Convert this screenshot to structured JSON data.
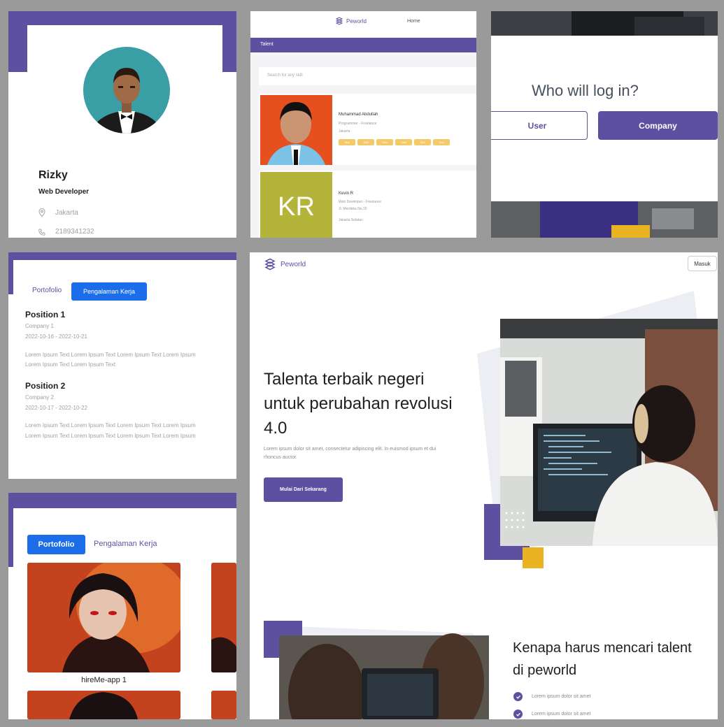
{
  "profile": {
    "name": "Rizky",
    "role": "Web Developer",
    "location": "Jakarta",
    "phone": "2189341232"
  },
  "talent_list": {
    "brand": "Peworld",
    "nav_link": "Home",
    "bar_title": "Talent",
    "search_placeholder": "Search for any skill",
    "items": [
      {
        "photo": "person-photo",
        "name": "Muhammad Abdullah",
        "role": "Programmer - Freelance",
        "location": "Jakarta",
        "skills": [
          "Skill",
          "Skill",
          "Skill",
          "Skill",
          "Skill",
          "Skill"
        ]
      },
      {
        "initials": "KR",
        "name": "Kevin R",
        "role": "Web Developer - Freelance",
        "location": "Jl. Merdeka No.15",
        "extra": "Jakarta Selatan"
      }
    ]
  },
  "login": {
    "question": "Who will log in?",
    "user_label": "User",
    "company_label": "Company"
  },
  "experience": {
    "tab_portfolio": "Portofolio",
    "tab_experience": "Pengalaman Kerja",
    "positions": [
      {
        "title": "Position 1",
        "company": "Company 1",
        "dates": "2022-10-16 - 2022-10-21",
        "desc1": "Lorem Ipsum Text Lorem Ipsum Text Lorem Ipsum Text Lorem Ipsum",
        "desc2": "Lorem Ipsum Text Lorem Ipsum Text"
      },
      {
        "title": "Position 2",
        "company": "Company 2",
        "dates": "2022-10-17 - 2022-10-22",
        "desc1": "Lorem Ipsum Text Lorem Ipsum Text Lorem Ipsum Text Lorem Ipsum",
        "desc2": "Lorem Ipsum Text Lorem Ipsum Text Lorem Ipsum Text Lorem Ipsum"
      }
    ]
  },
  "portfolio": {
    "tab_portfolio": "Portofolio",
    "tab_experience": "Pengalaman Kerja",
    "caption": "hireMe-app 1"
  },
  "landing": {
    "brand": "Peworld",
    "login_button": "Masuk",
    "headline": "Talenta terbaik negeri untuk perubahan revolusi 4.0",
    "lead": "Lorem ipsum dolor sit amet, consectetur adipiscing elit. In euismod ipsum et dui rhoncus auctor.",
    "cta": "Mulai Dari Sekarang",
    "section_title_1": "Kenapa harus mencari talent",
    "section_title_2": "di peworld",
    "bullets": [
      "Lorem ipsum dolor sit amet",
      "Lorem ipsum dolor sit amet"
    ]
  },
  "colors": {
    "brand_purple": "#5e50a1",
    "tab_blue": "#1c6dea",
    "skill_yellow": "#f3ca67",
    "accent_yellow": "#e9b322"
  }
}
